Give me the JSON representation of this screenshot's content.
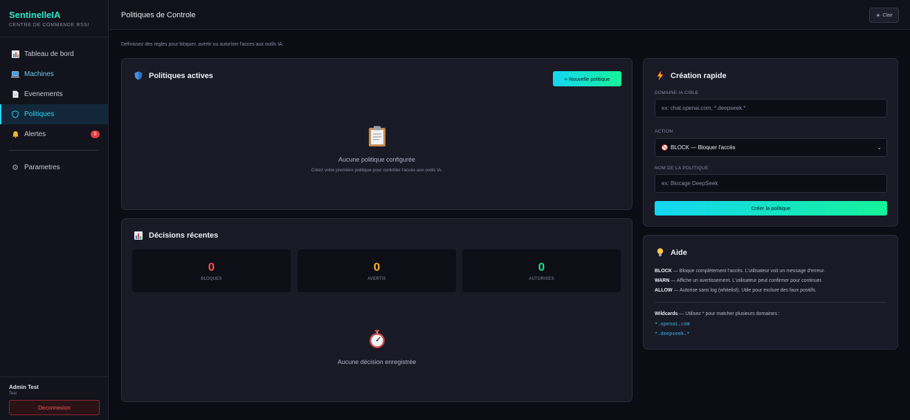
{
  "brand": {
    "name": "SentinelleIA",
    "subtitle": "CENTRE DE COMMANDE RSSI"
  },
  "sidebar": {
    "items": [
      {
        "label": "Tableau de bord",
        "icon": "chart-icon"
      },
      {
        "label": "Machines",
        "icon": "laptop-icon"
      },
      {
        "label": "Evenements",
        "icon": "document-icon"
      },
      {
        "label": "Politiques",
        "icon": "shield-icon",
        "active": true
      },
      {
        "label": "Alertes",
        "icon": "bell-icon",
        "badge": "0"
      },
      {
        "label": "Parametres",
        "icon": "gear-icon"
      }
    ],
    "user": {
      "name": "Admin Test",
      "role": "Test"
    },
    "logout_label": "Deconnexion"
  },
  "header": {
    "title": "Politiques de Controle",
    "theme_label": "Clair"
  },
  "subtitle": "Definissez des regles pour bloquer, avertir ou autoriser l'acces aux outils IA.",
  "active_policies": {
    "title": "Politiques actives",
    "new_button": "+ Nouvelle politique",
    "empty_title": "Aucune politique configurée",
    "empty_sub": "Créez votre première politique pour contrôler l'accès aux outils IA."
  },
  "recent": {
    "title": "Décisions récentes",
    "stats": [
      {
        "value": "0",
        "label": "BLOQUES",
        "color": "#ff4d4d"
      },
      {
        "value": "0",
        "label": "AVERTIS",
        "color": "#ffb020"
      },
      {
        "value": "0",
        "label": "AUTORISES",
        "color": "#22e08a"
      }
    ],
    "empty_title": "Aucune décision enregistrée"
  },
  "quick": {
    "title": "Création rapide",
    "domain_label": "DOMAINE IA CIBLE",
    "domain_placeholder": "ex: chat.openai.com, *.deepseek.*",
    "action_label": "ACTION",
    "action_value": "BLOCK — Bloquer l'accès",
    "name_label": "NOM DE LA POLITIQUE",
    "name_placeholder": "ex: Blocage DeepSeek",
    "submit": "Créer la politique"
  },
  "help": {
    "title": "Aide",
    "lines": [
      {
        "key": "BLOCK",
        "text": " — Bloque complètement l'accès. L'utilisateur voit un message d'erreur."
      },
      {
        "key": "WARN",
        "text": " — Affiche un avertissement. L'utilisateur peut confirmer pour continuer."
      },
      {
        "key": "ALLOW",
        "text": " — Autorise sans log (whitelist). Utile pour exclure des faux positifs."
      }
    ],
    "wildcards_key": "Wildcards",
    "wildcards_text": " — Utilisez * pour matcher plusieurs domaines :",
    "examples": [
      "*.openai.com",
      "*.deepseek.*"
    ]
  }
}
